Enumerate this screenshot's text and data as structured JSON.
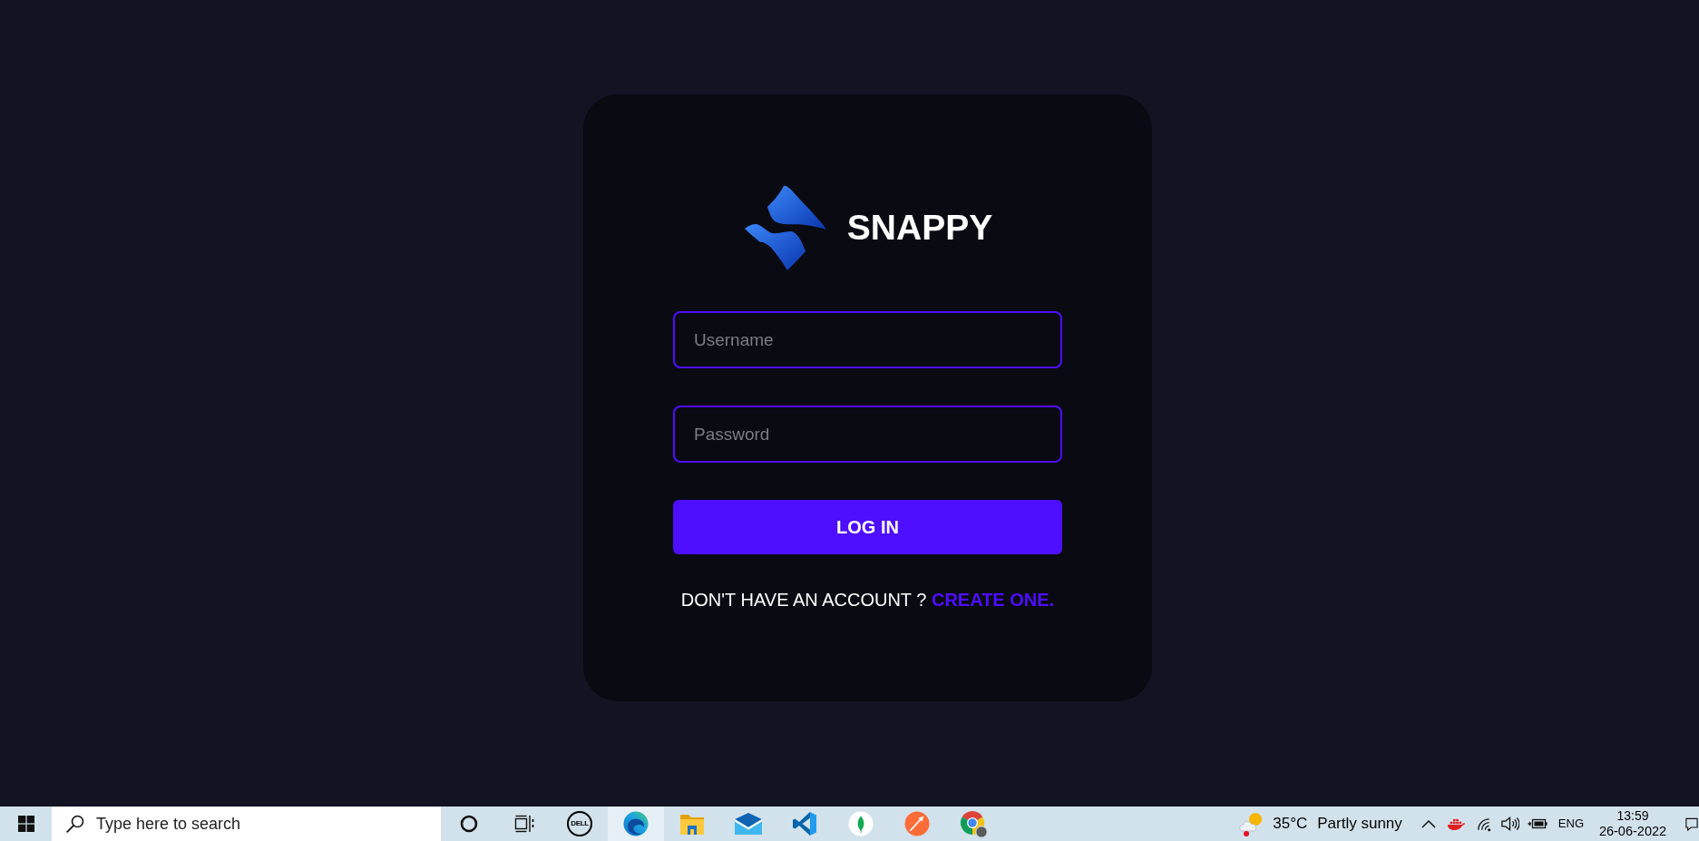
{
  "login": {
    "brand": "SNAPPY",
    "fields": [
      {
        "placeholder": "Username"
      },
      {
        "placeholder": "Password"
      }
    ],
    "submit": "LOG IN",
    "prompt": "DON'T HAVE AN ACCOUNT ?",
    "link": "CREATE ONE."
  },
  "taskbar": {
    "search": {
      "placeholder": "Type here to search"
    },
    "apps": [
      {
        "label": "DELL",
        "selected": false
      },
      {
        "selected": true
      },
      {
        "selected": false
      },
      {
        "selected": false
      },
      {
        "selected": false
      },
      {
        "selected": false
      },
      {
        "selected": false
      },
      {
        "selected": false
      }
    ],
    "weather": {
      "temperature": "35°C",
      "condition": "Partly sunny"
    },
    "language": "ENG",
    "time": "13:59",
    "date": "26-06-2022"
  }
}
